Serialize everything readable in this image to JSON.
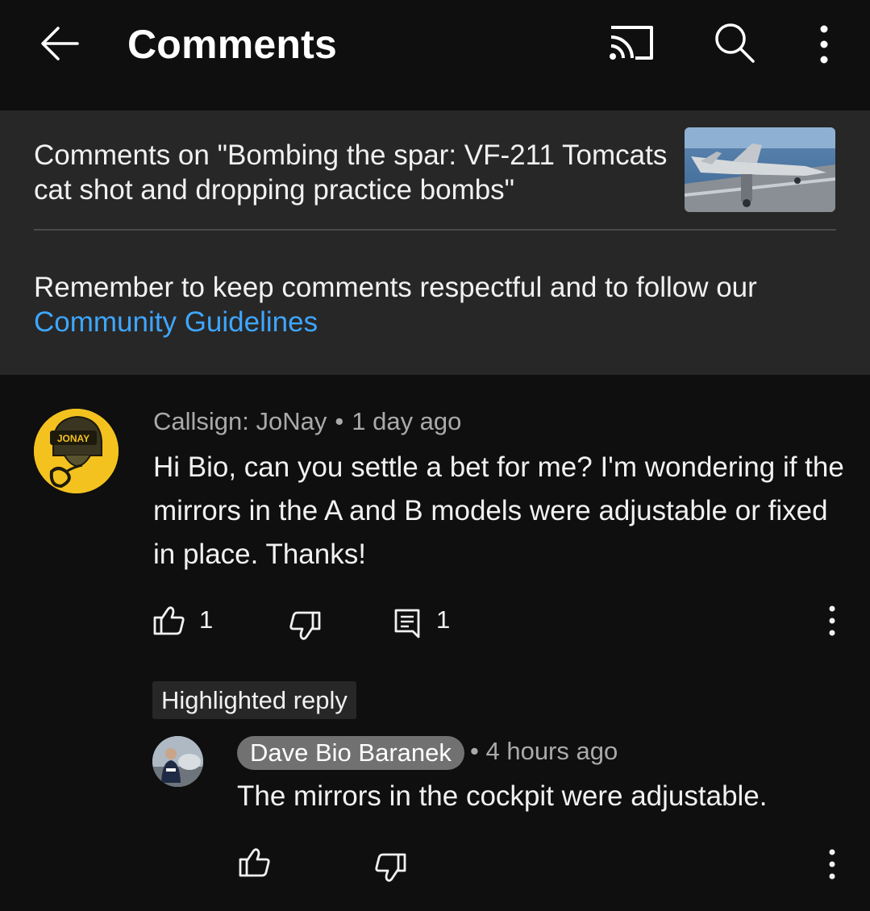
{
  "header": {
    "title": "Comments"
  },
  "video": {
    "comments_on": "Comments on \"Bombing the spar: VF-211 Tomcats cat shot and dropping practice bombs\""
  },
  "notice": {
    "text": "Remember to keep comments respectful and to follow our ",
    "link": "Community Guidelines"
  },
  "comment": {
    "author": "Callsign: JoNay",
    "separator": "•",
    "time": "1 day ago",
    "text": "Hi Bio, can you settle a bet for me? I'm wondering if the mirrors in the A and B models were adjustable or fixed in place. Thanks!",
    "likes": "1",
    "replies": "1",
    "avatar_text": "JONAY"
  },
  "highlighted_reply": {
    "label": "Highlighted reply",
    "author": "Dave Bio Baranek",
    "separator": "•",
    "time": "4 hours ago",
    "text": "The mirrors in the cockpit were adjustable."
  },
  "icons": [
    "back-arrow-icon",
    "cast-icon",
    "search-icon",
    "more-vert-icon",
    "thumbs-up-icon",
    "thumbs-down-icon",
    "reply-icon"
  ],
  "colors": {
    "background": "#0f0f0f",
    "panel": "#272727",
    "link": "#3ea6ff",
    "secondary_text": "#aaaaaa",
    "author_chip": "#717171",
    "avatar_yellow": "#f4c21f"
  }
}
